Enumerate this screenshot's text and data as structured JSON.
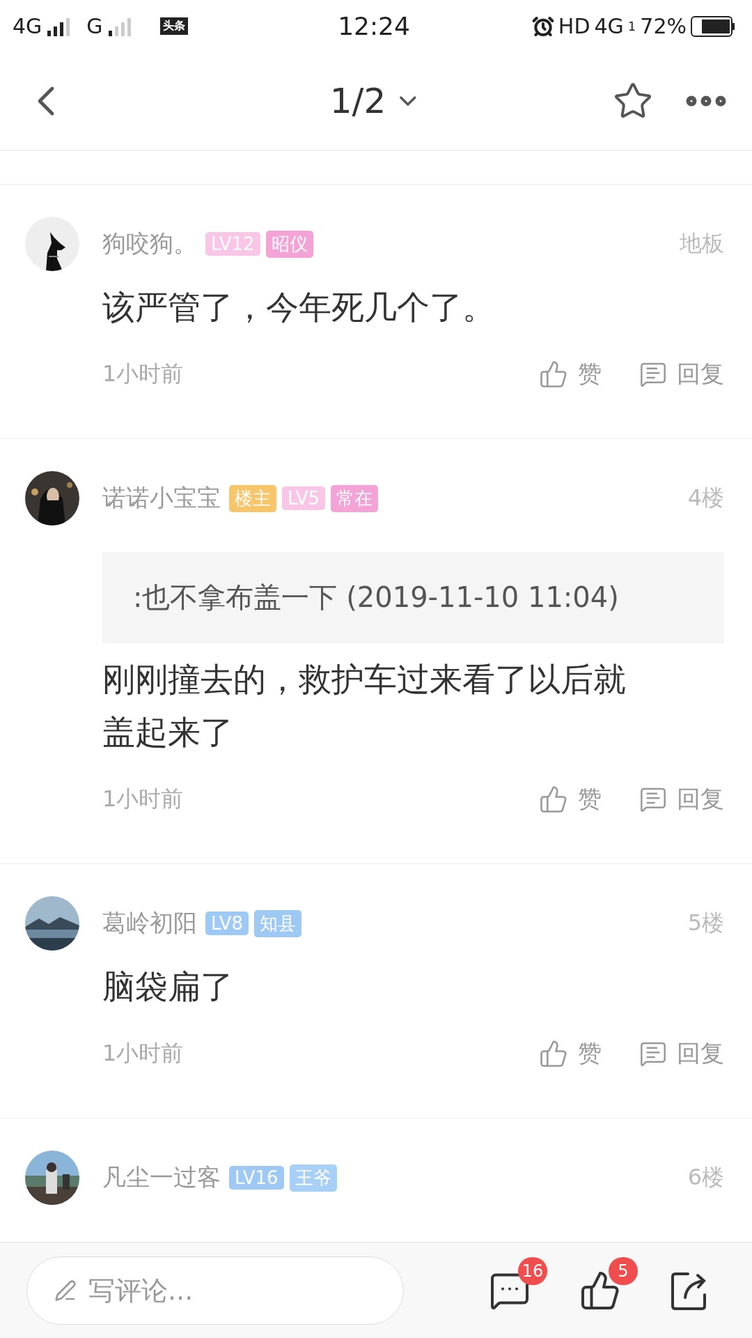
{
  "status_bar": {
    "network_1": "4G",
    "network_2": "G",
    "app_badge": "头条",
    "time": "12:24",
    "hd": "HD",
    "network_3": "4G",
    "sim": "1",
    "battery": "72%"
  },
  "header": {
    "page": "1/2"
  },
  "comments": [
    {
      "user": "狗咬狗。",
      "badges": [
        {
          "text": "LV12",
          "color": "#f9c6e8"
        },
        {
          "text": "昭仪",
          "color": "#f4a3d6"
        }
      ],
      "floor": "地板",
      "text": "该严管了，今年死几个了。",
      "time": "1小时前",
      "like_label": "赞",
      "reply_label": "回复"
    },
    {
      "user": "诺诺小宝宝",
      "badges": [
        {
          "text": "楼主",
          "color": "#f8c66a"
        },
        {
          "text": "LV5",
          "color": "#f9c6e8"
        },
        {
          "text": "常在",
          "color": "#f4a3d6"
        }
      ],
      "floor": "4楼",
      "quote": ":也不拿布盖一下 (2019-11-10 11:04)",
      "text": "刚刚撞去的，救护车过来看了以后就盖起来了",
      "time": "1小时前",
      "like_label": "赞",
      "reply_label": "回复"
    },
    {
      "user": "葛岭初阳",
      "badges": [
        {
          "text": "LV8",
          "color": "#9ec9f5"
        },
        {
          "text": "知县",
          "color": "#9ec9f5"
        }
      ],
      "floor": "5楼",
      "text": "脑袋扁了",
      "time": "1小时前",
      "like_label": "赞",
      "reply_label": "回复"
    },
    {
      "user": "凡尘一过客",
      "badges": [
        {
          "text": "LV16",
          "color": "#9ec9f5"
        },
        {
          "text": "王爷",
          "color": "#a8d0f7"
        }
      ],
      "floor": "6楼"
    }
  ],
  "bottom_bar": {
    "placeholder": "写评论...",
    "comment_count": "16",
    "like_count": "5"
  }
}
